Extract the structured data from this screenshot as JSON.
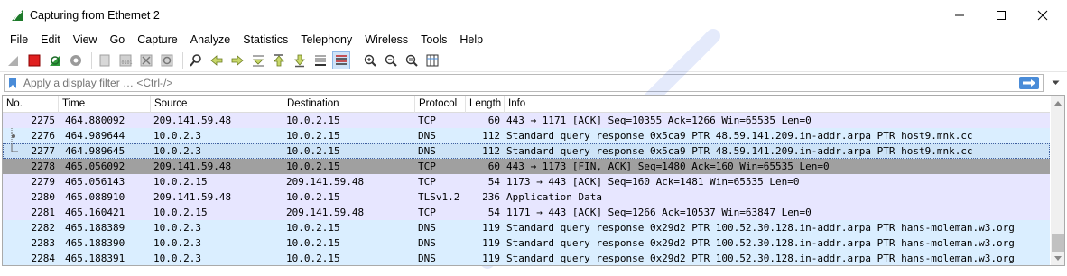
{
  "window": {
    "title": "Capturing from Ethernet 2",
    "min_glyph": "—",
    "max_glyph": "☐",
    "close_glyph": "✕"
  },
  "menu": [
    "File",
    "Edit",
    "View",
    "Go",
    "Capture",
    "Analyze",
    "Statistics",
    "Telephony",
    "Wireless",
    "Tools",
    "Help"
  ],
  "toolbar": {
    "icons": [
      "shark-fin-start-icon",
      "stop-capture-icon",
      "restart-capture-icon",
      "capture-options-icon",
      "open-file-icon",
      "save-file-icon",
      "close-file-icon",
      "reload-file-icon",
      "find-packet-icon",
      "go-back-icon",
      "go-forward-icon",
      "go-to-packet-icon",
      "go-first-icon",
      "go-last-icon",
      "auto-scroll-icon",
      "colorize-icon",
      "zoom-in-icon",
      "zoom-out-icon",
      "normal-size-icon",
      "resize-columns-icon"
    ]
  },
  "filter": {
    "placeholder": "Apply a display filter … <Ctrl-/>"
  },
  "columns": [
    "No.",
    "Time",
    "Source",
    "Destination",
    "Protocol",
    "Length",
    "Info"
  ],
  "packets": [
    {
      "no": "2275",
      "time": "464.880092",
      "src": "209.141.59.48",
      "dst": "10.0.2.15",
      "proto": "TCP",
      "len": "60",
      "info": "443 → 1171 [ACK] Seq=10355 Ack=1266 Win=65535 Len=0",
      "kind": "tcp"
    },
    {
      "no": "2276",
      "time": "464.989644",
      "src": "10.0.2.3",
      "dst": "10.0.2.15",
      "proto": "DNS",
      "len": "112",
      "info": "Standard query response 0x5ca9 PTR 48.59.141.209.in-addr.arpa PTR host9.mnk.cc",
      "kind": "dns"
    },
    {
      "no": "2277",
      "time": "464.989645",
      "src": "10.0.2.3",
      "dst": "10.0.2.15",
      "proto": "DNS",
      "len": "112",
      "info": "Standard query response 0x5ca9 PTR 48.59.141.209.in-addr.arpa PTR host9.mnk.cc",
      "kind": "sel"
    },
    {
      "no": "2278",
      "time": "465.056092",
      "src": "209.141.59.48",
      "dst": "10.0.2.15",
      "proto": "TCP",
      "len": "60",
      "info": "443 → 1173 [FIN, ACK] Seq=1480 Ack=160 Win=65535 Len=0",
      "kind": "fin"
    },
    {
      "no": "2279",
      "time": "465.056143",
      "src": "10.0.2.15",
      "dst": "209.141.59.48",
      "proto": "TCP",
      "len": "54",
      "info": "1173 → 443 [ACK] Seq=160 Ack=1481 Win=65535 Len=0",
      "kind": "tcp"
    },
    {
      "no": "2280",
      "time": "465.088910",
      "src": "209.141.59.48",
      "dst": "10.0.2.15",
      "proto": "TLSv1.2",
      "len": "236",
      "info": "Application Data",
      "kind": "tcp"
    },
    {
      "no": "2281",
      "time": "465.160421",
      "src": "10.0.2.15",
      "dst": "209.141.59.48",
      "proto": "TCP",
      "len": "54",
      "info": "1171 → 443 [ACK] Seq=1266 Ack=10537 Win=63847 Len=0",
      "kind": "tcp"
    },
    {
      "no": "2282",
      "time": "465.188389",
      "src": "10.0.2.3",
      "dst": "10.0.2.15",
      "proto": "DNS",
      "len": "119",
      "info": "Standard query response 0x29d2 PTR 100.52.30.128.in-addr.arpa PTR hans-moleman.w3.org",
      "kind": "dns"
    },
    {
      "no": "2283",
      "time": "465.188390",
      "src": "10.0.2.3",
      "dst": "10.0.2.15",
      "proto": "DNS",
      "len": "119",
      "info": "Standard query response 0x29d2 PTR 100.52.30.128.in-addr.arpa PTR hans-moleman.w3.org",
      "kind": "dns"
    },
    {
      "no": "2284",
      "time": "465.188391",
      "src": "10.0.2.3",
      "dst": "10.0.2.15",
      "proto": "DNS",
      "len": "119",
      "info": "Standard query response 0x29d2 PTR 100.52.30.128.in-addr.arpa PTR hans-moleman.w3.org",
      "kind": "dns"
    }
  ],
  "colors": {
    "accent": "#4a8cd8",
    "tcp_row": "#e7e6ff",
    "dns_row": "#daeeff",
    "fin_row": "#a0a0a0",
    "stop_red": "#e02020"
  }
}
